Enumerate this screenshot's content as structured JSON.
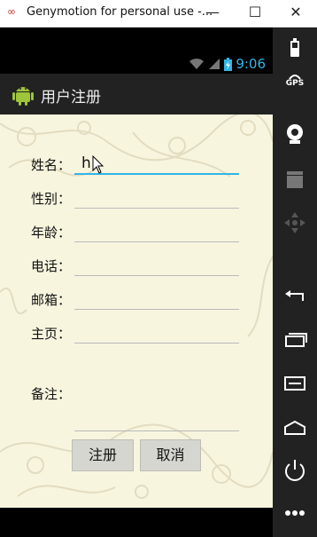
{
  "window": {
    "logo_text": "∞",
    "title": "Genymotion for personal use -...",
    "minimize": "—",
    "maximize": "☐",
    "close": "✕"
  },
  "status_bar": {
    "time": "9:06",
    "wifi_icon": "wifi-icon",
    "signal_icon": "signal-icon",
    "battery_icon": "battery-charging-icon",
    "accent_color": "#33b5e5"
  },
  "app_bar": {
    "title": "用户注册",
    "icon": "android-icon"
  },
  "form": {
    "fields": [
      {
        "label": "姓名：",
        "value": "h"
      },
      {
        "label": "性别：",
        "value": ""
      },
      {
        "label": "年龄：",
        "value": ""
      },
      {
        "label": "电话：",
        "value": ""
      },
      {
        "label": "邮箱：",
        "value": ""
      },
      {
        "label": "主页：",
        "value": ""
      },
      {
        "label": "备注：",
        "value": ""
      }
    ],
    "submit_label": "注册",
    "cancel_label": "取消",
    "background": "#f8f5df"
  },
  "sidebar": {
    "gps_label": "GPS",
    "items": [
      "battery-icon",
      "gps-icon",
      "webcam-icon",
      "clapper-icon",
      "dpad-icon",
      "back-icon",
      "recent-apps-icon",
      "menu-icon",
      "home-icon",
      "power-icon",
      "more-icon"
    ]
  }
}
